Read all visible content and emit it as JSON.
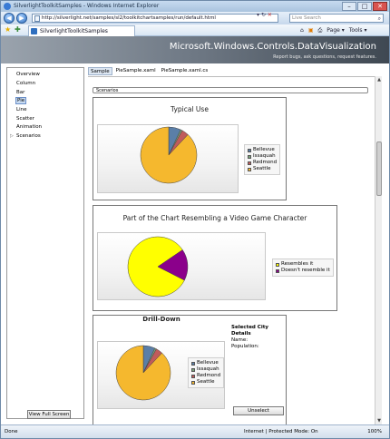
{
  "window": {
    "title": "SilverlightToolkitSamples - Windows Internet Explorer",
    "address": "http://silverlight.net/samples/sl2/toolkitchartsamples/run/default.html",
    "search_placeholder": "Live Search",
    "tab_label": "SilverlightToolkitSamples",
    "cmd_page": "Page",
    "cmd_tools": "Tools"
  },
  "banner": {
    "title": "Microsoft.Windows.Controls.DataVisualization",
    "subtitle": "Report bugs, ask questions, request features."
  },
  "sidebar": {
    "items": [
      {
        "label": "Overview"
      },
      {
        "label": "Column"
      },
      {
        "label": "Bar"
      },
      {
        "label": "Pie",
        "selected": true
      },
      {
        "label": "Line"
      },
      {
        "label": "Scatter"
      },
      {
        "label": "Animation"
      },
      {
        "label": "Scenarios",
        "expandable": true
      }
    ],
    "view_full_screen": "View Full Screen"
  },
  "tabs": [
    "Sample",
    "PieSample.xaml",
    "PieSample.xaml.cs"
  ],
  "scenarios_label": "Scenarios",
  "panels": {
    "typical": {
      "title": "Typical Use"
    },
    "pacman": {
      "title": "Part of the Chart Resembling a Video Game Character"
    },
    "drill": {
      "title": "Drill-Down",
      "details_heading": "Selected City Details",
      "name_label": "Name:",
      "population_label": "Population:",
      "unselect": "Unselect"
    }
  },
  "chart_data": [
    {
      "type": "pie",
      "title": "Typical Use",
      "categories": [
        "Bellevue",
        "Issaquah",
        "Redmond",
        "Seattle"
      ],
      "values": [
        7,
        1,
        4,
        88
      ],
      "colors": [
        "#5b7fa8",
        "#7aa37a",
        "#c05b5b",
        "#f5b82e"
      ]
    },
    {
      "type": "pie",
      "title": "Part of the Chart Resembling a Video Game Character",
      "categories": [
        "Resembles it",
        "Doesn't resemble it"
      ],
      "values": [
        83,
        17
      ],
      "colors": [
        "#ffff00",
        "#8b008b"
      ]
    },
    {
      "type": "pie",
      "title": "Drill-Down",
      "categories": [
        "Bellevue",
        "Issaquah",
        "Redmond",
        "Seattle"
      ],
      "values": [
        7,
        1,
        4,
        88
      ],
      "colors": [
        "#5b7fa8",
        "#7aa37a",
        "#c05b5b",
        "#f5b82e"
      ]
    }
  ],
  "status": {
    "left": "Done",
    "zone": "Internet | Protected Mode: On",
    "zoom": "100%"
  }
}
